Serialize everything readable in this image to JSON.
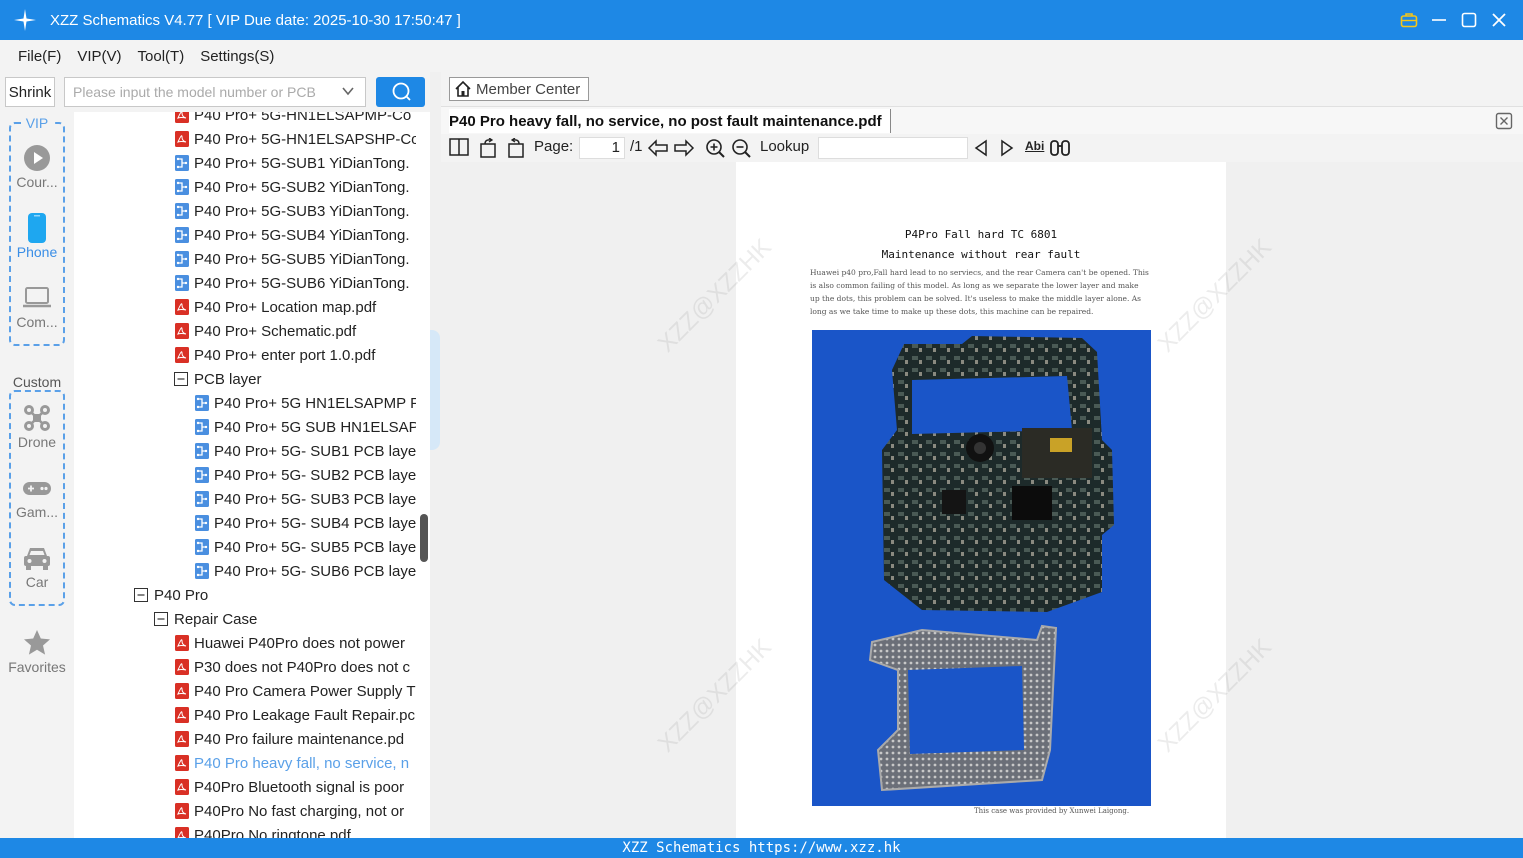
{
  "app": {
    "title": "XZZ Schematics V4.77 [ VIP Due date: 2025-10-30 17:50:47 ]"
  },
  "menu": [
    "File(F)",
    "VIP(V)",
    "Tool(T)",
    "Settings(S)"
  ],
  "search": {
    "shrink_label": "Shrink",
    "placeholder": "Please input the model number or PCB"
  },
  "sidebar": {
    "vip_label": "VIP",
    "custom_label": "Custom",
    "items": [
      {
        "label": "Cour...",
        "icon": "play-circle-icon"
      },
      {
        "label": "Phone",
        "icon": "phone-icon",
        "active": true
      },
      {
        "label": "Com...",
        "icon": "laptop-icon"
      },
      {
        "label": "Drone",
        "icon": "drone-icon"
      },
      {
        "label": "Gam...",
        "icon": "gamepad-icon"
      },
      {
        "label": "Car",
        "icon": "car-icon"
      },
      {
        "label": "Favorites",
        "icon": "star-icon"
      }
    ]
  },
  "tree": [
    {
      "type": "pdf",
      "level": 3,
      "label": "P40 Pro+ 5G-HN1ELSAPMP-Co"
    },
    {
      "type": "pdf",
      "level": 3,
      "label": "P40 Pro+ 5G-HN1ELSAPSHP-Co"
    },
    {
      "type": "pcb",
      "level": 3,
      "label": "P40 Pro+ 5G-SUB1 YiDianTong."
    },
    {
      "type": "pcb",
      "level": 3,
      "label": "P40 Pro+ 5G-SUB2 YiDianTong."
    },
    {
      "type": "pcb",
      "level": 3,
      "label": "P40 Pro+ 5G-SUB3 YiDianTong."
    },
    {
      "type": "pcb",
      "level": 3,
      "label": "P40 Pro+ 5G-SUB4 YiDianTong."
    },
    {
      "type": "pcb",
      "level": 3,
      "label": "P40 Pro+ 5G-SUB5 YiDianTong."
    },
    {
      "type": "pcb",
      "level": 3,
      "label": "P40 Pro+ 5G-SUB6 YiDianTong."
    },
    {
      "type": "pdf",
      "level": 3,
      "label": "P40 Pro+ Location map.pdf"
    },
    {
      "type": "pdf",
      "level": 3,
      "label": "P40 Pro+ Schematic.pdf"
    },
    {
      "type": "pdf",
      "level": 3,
      "label": "P40 Pro+ enter port 1.0.pdf"
    },
    {
      "type": "folder",
      "level": 3,
      "label": "PCB layer"
    },
    {
      "type": "pcb",
      "level": 4,
      "label": "P40 Pro+ 5G HN1ELSAPMP F"
    },
    {
      "type": "pcb",
      "level": 4,
      "label": "P40 Pro+ 5G SUB HN1ELSAP"
    },
    {
      "type": "pcb",
      "level": 4,
      "label": "P40 Pro+ 5G- SUB1 PCB laye"
    },
    {
      "type": "pcb",
      "level": 4,
      "label": "P40 Pro+ 5G- SUB2 PCB laye"
    },
    {
      "type": "pcb",
      "level": 4,
      "label": "P40 Pro+ 5G- SUB3 PCB laye"
    },
    {
      "type": "pcb",
      "level": 4,
      "label": "P40 Pro+ 5G- SUB4 PCB laye"
    },
    {
      "type": "pcb",
      "level": 4,
      "label": "P40 Pro+ 5G- SUB5 PCB laye"
    },
    {
      "type": "pcb",
      "level": 4,
      "label": "P40 Pro+ 5G- SUB6 PCB laye"
    },
    {
      "type": "folder",
      "level": 1,
      "label": "P40 Pro"
    },
    {
      "type": "folder",
      "level": 2,
      "label": "Repair Case"
    },
    {
      "type": "pdf",
      "level": 3,
      "label": "Huawei P40Pro does not power"
    },
    {
      "type": "pdf",
      "level": 3,
      "label": "P30 does not P40Pro does not c"
    },
    {
      "type": "pdf",
      "level": 3,
      "label": "P40 Pro Camera Power Supply T"
    },
    {
      "type": "pdf",
      "level": 3,
      "label": "P40 Pro Leakage Fault Repair.pc"
    },
    {
      "type": "pdf",
      "level": 3,
      "label": "P40 Pro failure maintenance.pd"
    },
    {
      "type": "pdf",
      "level": 3,
      "label": "P40 Pro heavy fall, no service, n",
      "selected": true
    },
    {
      "type": "pdf",
      "level": 3,
      "label": "P40Pro Bluetooth signal is poor"
    },
    {
      "type": "pdf",
      "level": 3,
      "label": "P40Pro No fast charging, not or"
    },
    {
      "type": "pdf",
      "level": 3,
      "label": "P40Pro No ringtone.pdf"
    }
  ],
  "viewer": {
    "member_center": "Member Center",
    "tab_title": "P40 Pro heavy fall, no service, no post fault maintenance.pdf",
    "page_label": "Page:",
    "page_current": "1",
    "page_total": "/1",
    "lookup_label": "Lookup",
    "find_label": "Abi"
  },
  "document": {
    "title": "P4Pro Fall hard TC 6801",
    "subtitle": "Maintenance without rear fault",
    "body": "Huawei p40 pro,Fall hard lead to no serviecs, and the rear Camera can't be opened. This is also common failing of this model. As long as we separate the lower layer and make up the dots, this problem can be solved. It's useless to make the middle layer alone. As long as we take time to make up these dots, this machine can be repaired.",
    "credit": "This case was provided by Xunwei Laigong.",
    "watermark": "XZZ@XZZHK"
  },
  "status": {
    "text": "XZZ Schematics https://www.xzz.hk"
  },
  "colors": {
    "accent": "#1e88e5",
    "pdf_icon": "#d93025",
    "pcb_icon": "#4a8fe0",
    "selected_text": "#5aa0e8"
  }
}
